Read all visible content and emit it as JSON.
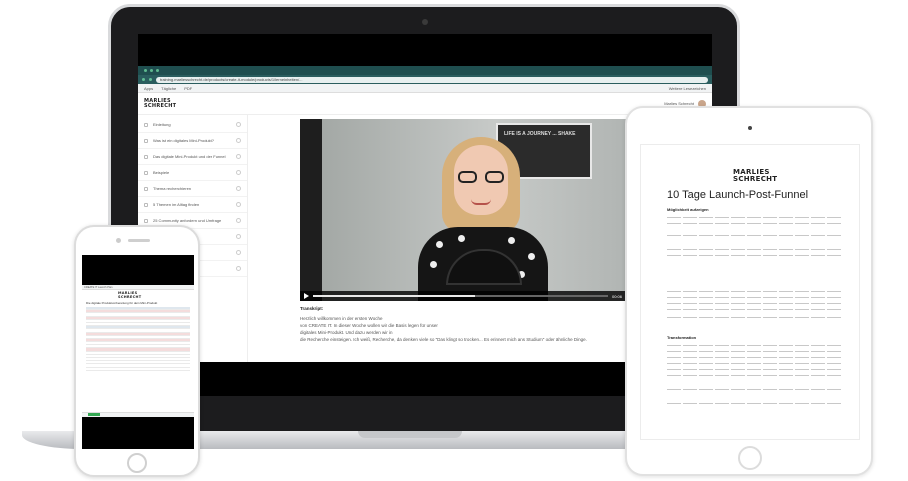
{
  "laptop": {
    "browser": {
      "url": "training.marliesschrecht.de/products/create-it-module/products/1/lerneinheiten/...",
      "bookmarks": [
        "Apps",
        "Tägliche",
        "PDF"
      ],
      "bookmark_right": "Weitere Lesezeichen"
    },
    "site": {
      "logo_line1": "MARLIES",
      "logo_line2": "SCHRECHT",
      "user_name": "Marlies Schrecht"
    },
    "lessons": [
      "Einleitung",
      "Was ist ein digitales Mini-Produkt?",
      "Das digitale Mini-Produkt und der Funnel",
      "Beispiele",
      "Thema recherchieren",
      "5 Themen im Alltag finden",
      "25 Community anfordern und Umfrage",
      "",
      "",
      ""
    ],
    "video": {
      "poster_text": "LIFE IS A JOURNEY ... SHAKE",
      "time": "00:06",
      "progress": 0.55
    },
    "transcript": {
      "heading": "Transkript:",
      "lines": [
        "Herzlich willkommen in der ersten Woche",
        "von CREATE IT. In dieser Woche wollen wir die Basis legen für unser",
        "digitales Mini-Produkt. Und dazu werden wir in",
        "die Recherche einsteigen. Ich weiß, Recherche, da denken viele so \"Das klingt so trocken... Es erinnert mich ans Studium\" oder ähnliche Dinge."
      ]
    }
  },
  "phone": {
    "sheet_title_bar": "CREATE IT Launch Plan",
    "sheet_heading": "Die digitale Produktvorbereitung für dein Mini-Produkt"
  },
  "tablet": {
    "logo_line1": "MARLIES",
    "logo_line2": "SCHRECHT",
    "doc_title": "10 Tage Launch-Post-Funnel",
    "section1": "Möglichkeit aufzeigen",
    "section2": "Transformation"
  }
}
